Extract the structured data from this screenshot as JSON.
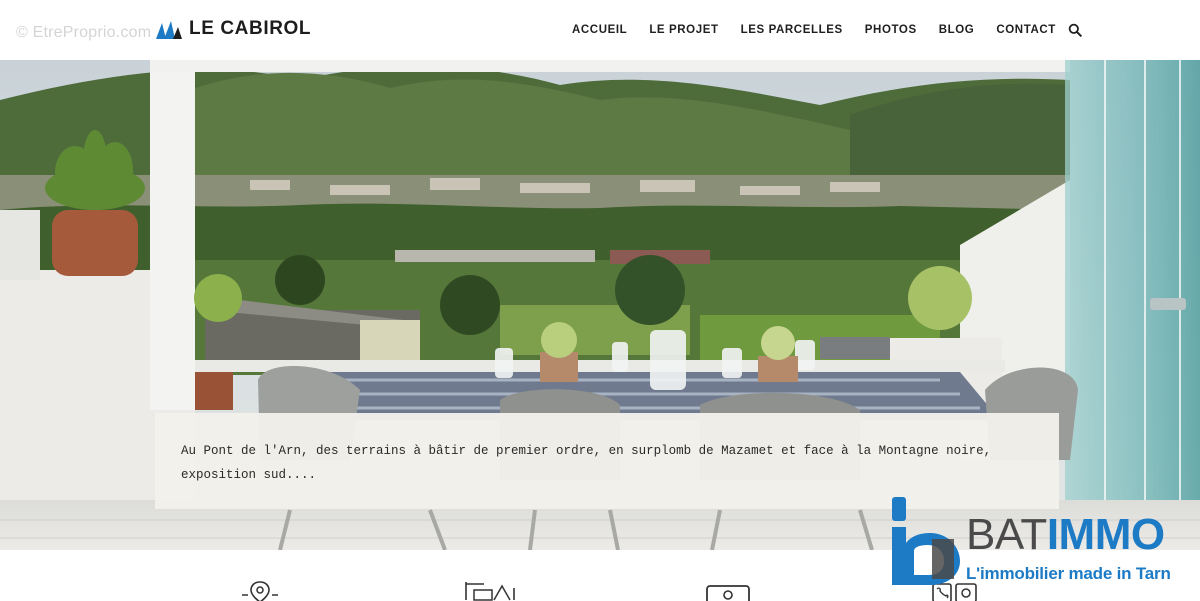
{
  "watermark": "© EtreProprio.com",
  "brand": {
    "name": "LE CABIROL",
    "accent_color": "#1d7bc6"
  },
  "nav": {
    "items": [
      "ACCUEIL",
      "LE PROJET",
      "LES PARCELLES",
      "PHOTOS",
      "BLOG",
      "CONTACT"
    ],
    "search_icon": "search-icon"
  },
  "hero": {
    "image": "terrace-mountain-view-photo",
    "caption": "Au Pont de l'Arn, des terrains à bâtir de premier ordre, en surplomb de Mazamet et face à la Montagne noire, exposition sud...."
  },
  "features": {
    "icons": [
      "location-pin-icon",
      "construction-icon",
      "photo-icon",
      "contact-icon"
    ]
  },
  "overlay_logo": {
    "name_light": "BAT",
    "name_bold": "IMMO",
    "slogan": "L'immobilier made in Tarn"
  }
}
